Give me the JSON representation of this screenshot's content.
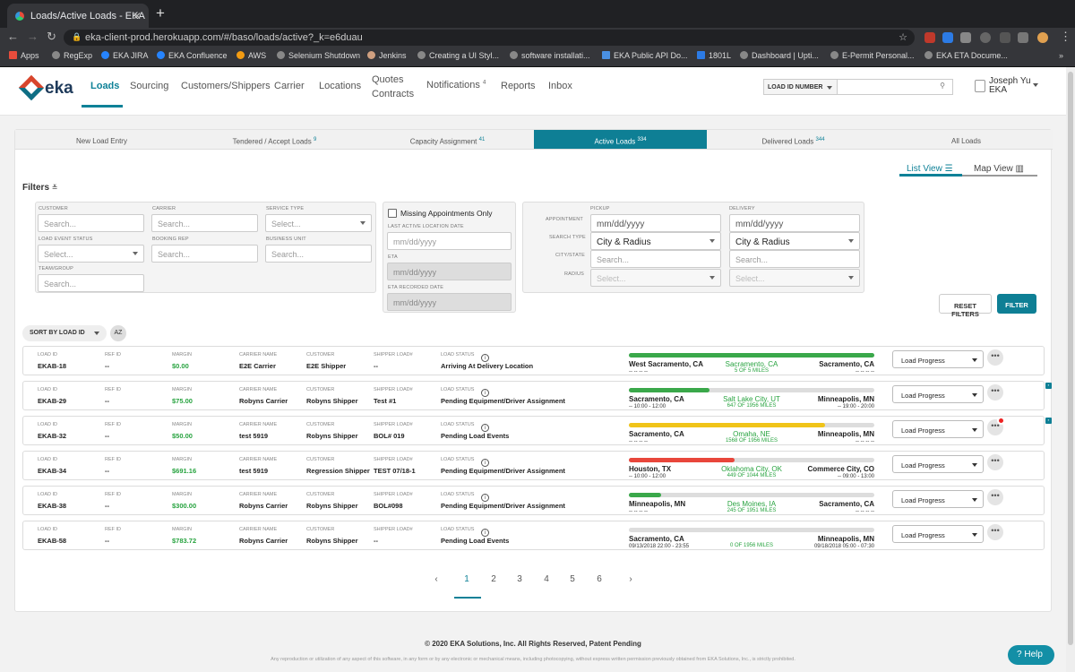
{
  "browser": {
    "tab_title": "Loads/Active Loads - EKA",
    "url": "eka-client-prod.herokuapp.com/#/baso/loads/active?_k=e6duau",
    "bookmarks": [
      "Apps",
      "RegExp",
      "EKA JIRA",
      "EKA Confluence",
      "AWS",
      "Selenium Shutdown",
      "Jenkins",
      "Creating a UI Styl...",
      "software installati...",
      "EKA Public API Do...",
      "1801L",
      "Dashboard | Upti...",
      "E-Permit Personal...",
      "EKA ETA Docume..."
    ]
  },
  "header": {
    "logo_text": "eka",
    "nav": [
      "Loads",
      "Sourcing",
      "Customers/Shippers",
      "Carrier",
      "Locations",
      "Quotes",
      "Contracts",
      "Notifications",
      "Reports",
      "Inbox"
    ],
    "notifications_count": "4",
    "search_type": "LOAD ID NUMBER",
    "user_name": "Joseph Yu",
    "user_org": "EKA"
  },
  "subtabs": [
    {
      "label": "New Load Entry",
      "count": ""
    },
    {
      "label": "Tendered / Accept Loads",
      "count": "9"
    },
    {
      "label": "Capacity Assignment",
      "count": "41"
    },
    {
      "label": "Active Loads",
      "count": "334"
    },
    {
      "label": "Delivered Loads",
      "count": "344"
    },
    {
      "label": "All Loads",
      "count": ""
    }
  ],
  "view": {
    "list": "List View",
    "map": "Map View"
  },
  "filters": {
    "title": "Filters",
    "customer": "CUSTOMER",
    "carrier": "CARRIER",
    "service_type": "SERVICE TYPE",
    "load_event_status": "LOAD EVENT STATUS",
    "booking_rep": "BOOKING REP",
    "business_unit": "BUSINESS UNIT",
    "team_group": "TEAM/GROUP",
    "search_ph": "Search...",
    "select_ph": "Select...",
    "missing_appts": "Missing Appointments Only",
    "last_active_date": "LAST ACTIVE LOCATION DATE",
    "eta": "ETA",
    "eta_recorded": "ETA RECORDED DATE",
    "date_ph": "mm/dd/yyyy",
    "pickup": "PICKUP",
    "delivery": "DELIVERY",
    "appointment": "APPOINTMENT",
    "search_type": "SEARCH TYPE",
    "city_state": "CITY/STATE",
    "radius": "RADIUS",
    "city_radius": "City & Radius",
    "reset": "RESET FILTERS",
    "filter": "FILTER"
  },
  "sort": {
    "label": "SORT BY LOAD ID",
    "az": "AZ"
  },
  "columns": {
    "load_id": "LOAD ID",
    "ref_id": "REF ID",
    "margin": "MARGIN",
    "carrier": "CARRIER NAME",
    "customer": "CUSTOMER",
    "shipper": "SHIPPER LOAD#",
    "status": "LOAD STATUS"
  },
  "loads": [
    {
      "load_id": "EKAB-18",
      "ref_id": "--",
      "margin": "$0.00",
      "carrier": "E2E Carrier",
      "customer": "E2E Shipper",
      "shipper": "--",
      "status": "Arriving At Delivery Location",
      "origin": "West Sacramento, CA",
      "current": "Sacramento, CA",
      "miles": "5 OF 5 MILES",
      "dest": "Sacramento, CA",
      "pickup_time": "-- -- -- --",
      "delivery_time": "-- -- -- --",
      "progress": 1.0,
      "color": "#3aa84a"
    },
    {
      "load_id": "EKAB-29",
      "ref_id": "--",
      "margin": "$75.00",
      "carrier": "Robyns Carrier",
      "customer": "Robyns Shipper",
      "shipper": "Test #1",
      "status": "Pending Equipment/Driver Assignment",
      "origin": "Sacramento, CA",
      "current": "Salt Lake City, UT",
      "miles": "647 OF 1956 MILES",
      "dest": "Minneapolis, MN",
      "pickup_time": "-- 10:00 - 12:00",
      "delivery_time": "-- 19:00 - 20:00",
      "progress": 0.33,
      "color": "#3aa84a"
    },
    {
      "load_id": "EKAB-32",
      "ref_id": "--",
      "margin": "$50.00",
      "carrier": "test 5919",
      "customer": "Robyns Shipper",
      "shipper": "BOL# 019",
      "status": "Pending Load Events",
      "origin": "Sacramento, CA",
      "current": "Omaha, NE",
      "miles": "1568 OF 1956 MILES",
      "dest": "Minneapolis, MN",
      "pickup_time": "-- -- -- --",
      "delivery_time": "-- -- -- --",
      "progress": 0.8,
      "color": "#f0c419"
    },
    {
      "load_id": "EKAB-34",
      "ref_id": "--",
      "margin": "$691.16",
      "carrier": "test 5919",
      "customer": "Regression Shipper",
      "shipper": "TEST 07/18-1",
      "status": "Pending Equipment/Driver Assignment",
      "origin": "Houston, TX",
      "current": "Oklahoma City, OK",
      "miles": "449 OF 1044 MILES",
      "dest": "Commerce City, CO",
      "pickup_time": "-- 10:00 - 12:00",
      "delivery_time": "-- 09:00 - 13:00",
      "progress": 0.43,
      "color": "#e8463b"
    },
    {
      "load_id": "EKAB-38",
      "ref_id": "--",
      "margin": "$300.00",
      "carrier": "Robyns Carrier",
      "customer": "Robyns Shipper",
      "shipper": "BOL#098",
      "status": "Pending Equipment/Driver Assignment",
      "origin": "Minneapolis, MN",
      "current": "Des Moines, IA",
      "miles": "245 OF 1951 MILES",
      "dest": "Sacramento, CA",
      "pickup_time": "-- -- -- --",
      "delivery_time": "-- -- -- --",
      "progress": 0.13,
      "color": "#3aa84a"
    },
    {
      "load_id": "EKAB-58",
      "ref_id": "--",
      "margin": "$783.72",
      "carrier": "Robyns Carrier",
      "customer": "Robyns Shipper",
      "shipper": "--",
      "status": "Pending Load Events",
      "origin": "Sacramento, CA",
      "current": "",
      "miles": "0 OF 1956 MILES",
      "dest": "Minneapolis, MN",
      "pickup_time": "09/13/2018 22:00 - 23:55",
      "delivery_time": "09/18/2018 05:00 - 07:30",
      "progress": 0.0,
      "color": "#3aa84a"
    }
  ],
  "row_action": "Load Progress",
  "pagination": {
    "pages": [
      "1",
      "2",
      "3",
      "4",
      "5",
      "6"
    ],
    "current": "1",
    "prev": "‹",
    "next": "›"
  },
  "footer": {
    "copyright": "© 2020 EKA Solutions, Inc. All Rights Reserved, Patent Pending",
    "disclaimer": "Any reproduction or utilization of any aspect of this software, in any form or by any electronic or mechanical means, including photocopying, without express written permission previously obtained from EKA Solutions, Inc., is strictly prohibited."
  },
  "help": "Help",
  "colors": {
    "accent": "#0e7f95",
    "green": "#27a33f"
  }
}
